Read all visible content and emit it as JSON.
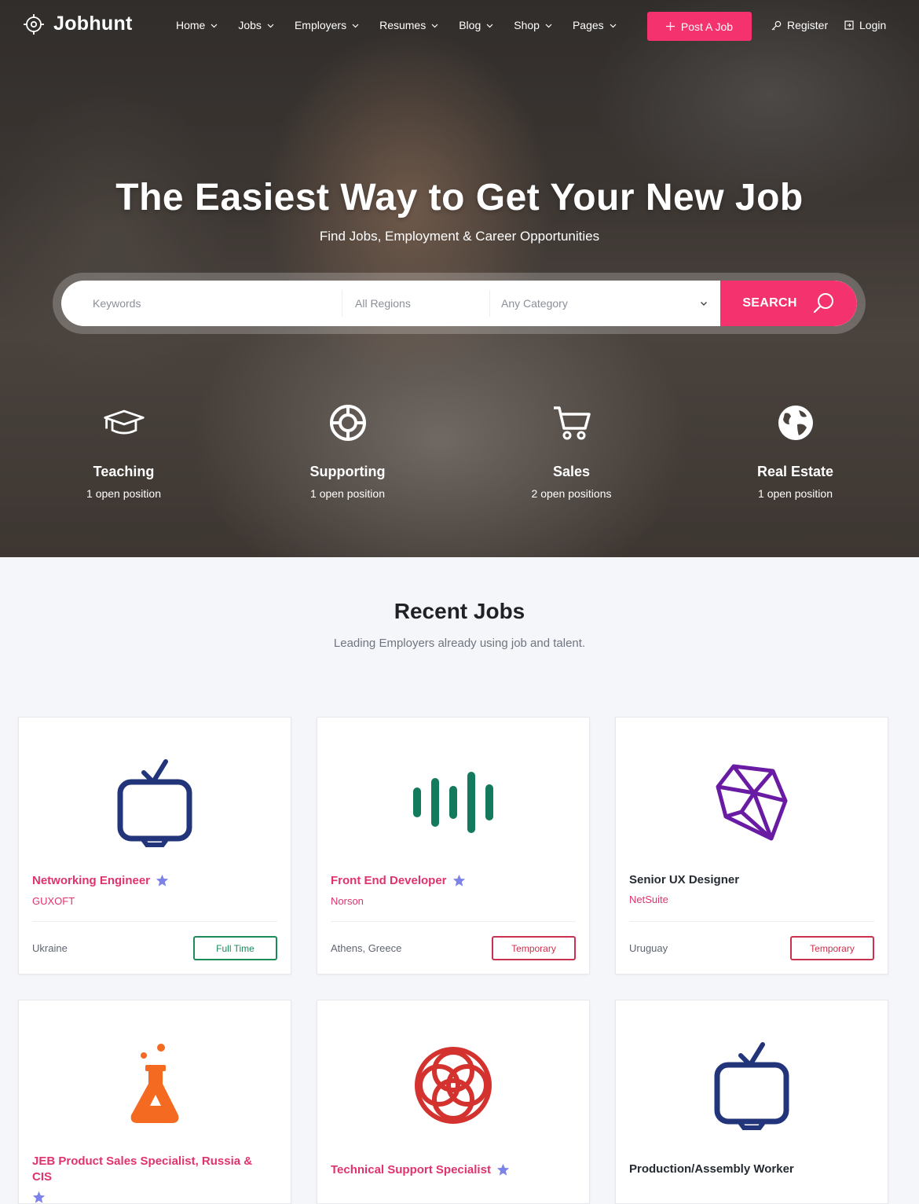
{
  "brand": {
    "name": "Jobhunt"
  },
  "nav": {
    "items": [
      {
        "label": "Home"
      },
      {
        "label": "Jobs"
      },
      {
        "label": "Employers"
      },
      {
        "label": "Resumes"
      },
      {
        "label": "Blog"
      },
      {
        "label": "Shop"
      },
      {
        "label": "Pages"
      }
    ],
    "post_job": "Post A Job",
    "register": "Register",
    "login": "Login"
  },
  "hero": {
    "title": "The Easiest Way to Get Your New Job",
    "subtitle": "Find Jobs, Employment & Career Opportunities"
  },
  "search": {
    "keywords_placeholder": "Keywords",
    "regions_placeholder": "All Regions",
    "category_value": "Any Category",
    "button": "SEARCH"
  },
  "categories": [
    {
      "name": "Teaching",
      "count": "1 open position",
      "icon": "graduation-cap-icon"
    },
    {
      "name": "Supporting",
      "count": "1 open position",
      "icon": "lifebuoy-icon"
    },
    {
      "name": "Sales",
      "count": "2 open positions",
      "icon": "cart-icon"
    },
    {
      "name": "Real Estate",
      "count": "1 open position",
      "icon": "globe-icon"
    }
  ],
  "recent": {
    "title": "Recent Jobs",
    "subtitle": "Leading Employers already using job and talent."
  },
  "jobs": [
    {
      "title": "Networking Engineer",
      "company": "GUXOFT",
      "location": "Ukraine",
      "type": "Full Time",
      "featured": true,
      "logo": "tv-icon",
      "logo_color": "#23357a"
    },
    {
      "title": "Front End Developer",
      "company": "Norson",
      "location": "Athens, Greece",
      "type": "Temporary",
      "featured": true,
      "logo": "sound-bars-icon",
      "logo_color": "#137a5e"
    },
    {
      "title": "Senior UX Designer",
      "company": "NetSuite",
      "location": "Uruguay",
      "type": "Temporary",
      "featured": false,
      "logo": "polyhedron-icon",
      "logo_color": "#6a1ba3"
    },
    {
      "title": "JEB Product Sales Specialist, Russia & CIS",
      "featured": true,
      "logo": "flask-icon",
      "logo_color": "#f36a20"
    },
    {
      "title": "Technical Support Specialist",
      "featured": true,
      "logo": "rings-icon",
      "logo_color": "#d3322e"
    },
    {
      "title": "Production/Assembly Worker",
      "featured": false,
      "logo": "tv-icon",
      "logo_color": "#23357a"
    }
  ],
  "colors": {
    "accent": "#f4336e",
    "job_title": "#e0336d",
    "star": "#7b83e8",
    "badge_full_time": "#1d8a5a",
    "badge_temporary": "#c9314e"
  }
}
